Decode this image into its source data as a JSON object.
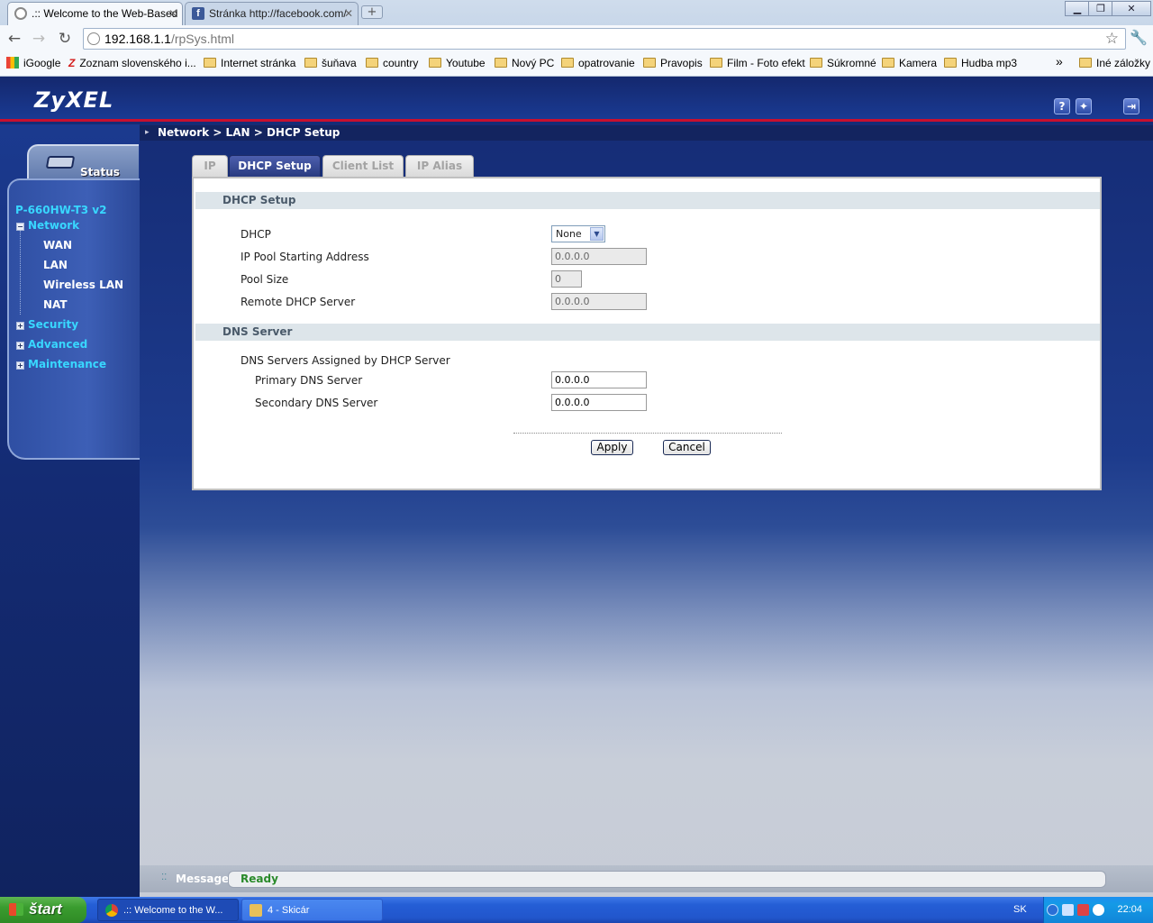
{
  "browser": {
    "tabs": [
      {
        "title": ".:: Welcome to the Web-Based",
        "active": true
      },
      {
        "title": "Stránka http://facebook.com/",
        "active": false
      }
    ],
    "new_tab": "+",
    "address": {
      "host": "192.168.1.1",
      "path": "/rpSys.html"
    },
    "bookmarks": [
      "iGoogle",
      "Zoznam slovenského i...",
      "Internet stránka",
      "šuňava",
      "country",
      "Youtube",
      "Nový PC",
      "opatrovanie",
      "Pravopis",
      "Film - Foto efekt",
      "Súkromné",
      "Kamera",
      "Hudba mp3"
    ],
    "bookmarks_overflow": "»",
    "other_bookmarks": "Iné záložky"
  },
  "zyxel": {
    "logo": "ZyXEL",
    "breadcrumb": "Network > LAN > DHCP Setup",
    "status_label": "Status",
    "model": "P-660HW-T3 v2",
    "menu": {
      "network": "Network",
      "wan": "WAN",
      "lan": "LAN",
      "wireless_lan": "Wireless LAN",
      "nat": "NAT",
      "security": "Security",
      "advanced": "Advanced",
      "maintenance": "Maintenance"
    },
    "tabs": [
      "IP",
      "DHCP Setup",
      "Client List",
      "IP Alias"
    ],
    "dhcp_section": {
      "title": "DHCP Setup",
      "dhcp_label": "DHCP",
      "dhcp_value": "None",
      "pool_start_label": "IP Pool Starting Address",
      "pool_start_value": "0.0.0.0",
      "pool_size_label": "Pool Size",
      "pool_size_value": "0",
      "remote_label": "Remote DHCP Server",
      "remote_value": "0.0.0.0"
    },
    "dns_section": {
      "title": "DNS Server",
      "assigned_label": "DNS Servers Assigned by DHCP Server",
      "primary_label": "Primary DNS Server",
      "primary_value": "0.0.0.0",
      "secondary_label": "Secondary DNS Server",
      "secondary_value": "0.0.0.0"
    },
    "buttons": {
      "apply": "Apply",
      "cancel": "Cancel"
    },
    "message": {
      "label": "Message",
      "value": "Ready"
    }
  },
  "taskbar": {
    "start": "štart",
    "tasks": [
      {
        "label": ".:: Welcome to the W...",
        "pressed": true
      },
      {
        "label": "4 - Skicár",
        "pressed": false
      }
    ],
    "lang": "SK",
    "clock": "22:04"
  },
  "colors": {
    "zyxel_navy": "#142a73",
    "accent_red": "#c8102e",
    "menu_cyan": "#38d7ff",
    "ready_green": "#2a8a2a"
  }
}
